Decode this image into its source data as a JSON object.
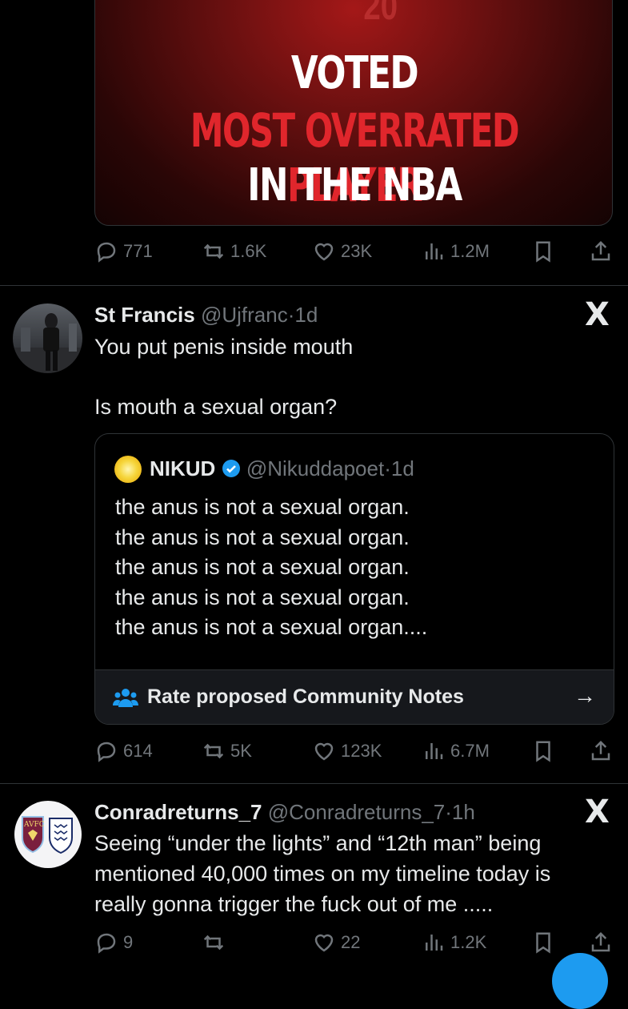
{
  "media": {
    "line1": "VOTED",
    "line2": "MOST OVERRATED PLAYER",
    "line3": "IN THE NBA",
    "jersey_partial": "20"
  },
  "tweet0_actions": {
    "replies": "771",
    "retweets": "1.6K",
    "likes": "23K",
    "views": "1.2M"
  },
  "tweet1": {
    "display_name": "St Francis",
    "handle": "@Ujfranc",
    "separator": "·",
    "time": "1d",
    "line1": "You put penis inside mouth",
    "line2": "Is mouth a sexual organ?",
    "quote": {
      "display_name": "NIKUD",
      "handle": "@Nikuddapoet",
      "separator": "·",
      "time": "1d",
      "lines": [
        "the anus is not a sexual organ.",
        "the anus is not a sexual organ.",
        "the anus is not a sexual organ.",
        "the anus is not a sexual organ.",
        "the anus is not a sexual organ...."
      ],
      "notes_label": "Rate proposed Community Notes",
      "notes_arrow": "→"
    },
    "actions": {
      "replies": "614",
      "retweets": "5K",
      "likes": "123K",
      "views": "6.7M"
    }
  },
  "tweet2": {
    "display_name": "Conradreturns_7",
    "handle": "@Conradreturns_7",
    "separator": "·",
    "time": "1h",
    "lines": [
      "Seeing “under the lights” and “12th man” being",
      "mentioned 40,000 times on my timeline today is",
      "really gonna trigger the fuck out of me ....."
    ],
    "avatar_text": "AVFC",
    "actions": {
      "replies": "9",
      "likes": "22",
      "views": "1.2K"
    }
  },
  "x_logo": "X",
  "colors": {
    "background": "#000000",
    "text": "#e7e9ea",
    "muted": "#71767b",
    "verified": "#1d9bf0",
    "media_red": "#e0262c"
  }
}
